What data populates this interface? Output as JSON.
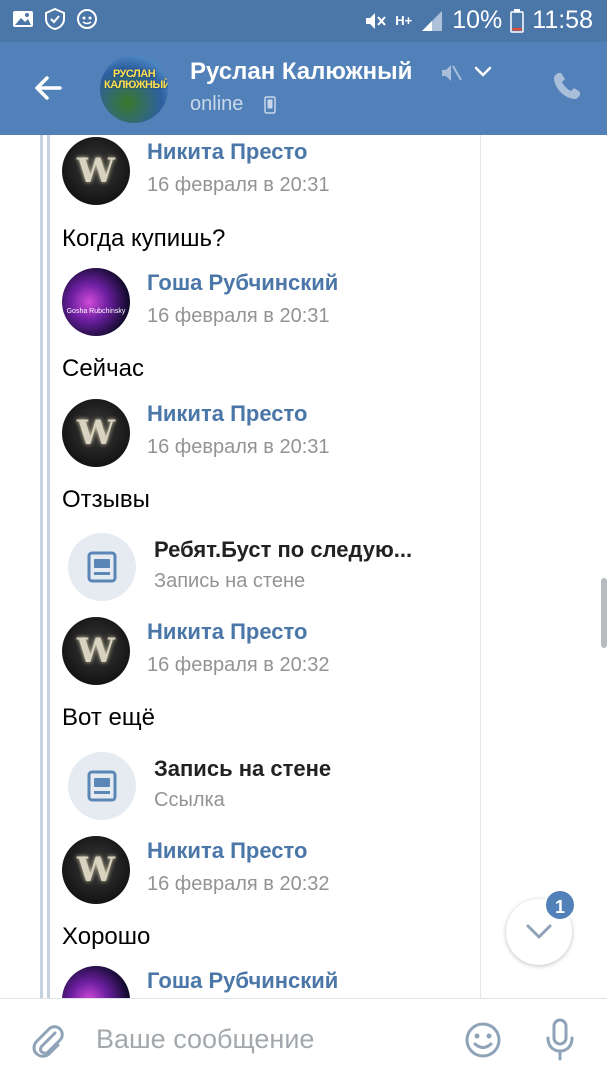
{
  "status_bar": {
    "battery": "10%",
    "time": "11:58",
    "network": "H+"
  },
  "header": {
    "title": "Руслан Калюжный",
    "status": "online",
    "avatar_text": "РУСЛАН КАЛЮЖНЫЙ"
  },
  "messages": [
    {
      "sender": "Никита Престо",
      "time": "16 февраля в 20:31",
      "text": "Когда купишь?"
    },
    {
      "sender": "Гоша Рубчинский",
      "time": "16 февраля в 20:31",
      "text": "Сейчас"
    },
    {
      "sender": "Никита Престо",
      "time": "16 февраля в 20:31",
      "text": "Отзывы",
      "attachment": {
        "title": "Ребят.Буст по следую...",
        "subtitle": "Запись на стене"
      }
    },
    {
      "sender": "Никита Престо",
      "time": "16 февраля в 20:32",
      "text": "Вот ещё",
      "attachment": {
        "title": "Запись на стене",
        "subtitle": "Ссылка"
      }
    },
    {
      "sender": "Никита Престо",
      "time": "16 февраля в 20:32",
      "text": "Хорошо"
    },
    {
      "sender": "Гоша Рубчинский",
      "time": ""
    }
  ],
  "scroll_down": {
    "badge": "1"
  },
  "composer": {
    "placeholder": "Ваше сообщение"
  },
  "colors": {
    "header": "#5181b8",
    "status_bar": "#4a76a8",
    "sender_name": "#4a76a8",
    "muted_text": "#939393"
  },
  "icons": [
    "back-arrow-icon",
    "mute-icon",
    "chevron-down-icon",
    "phone-icon",
    "wall-post-icon",
    "paperclip-icon",
    "smile-icon",
    "microphone-icon"
  ]
}
